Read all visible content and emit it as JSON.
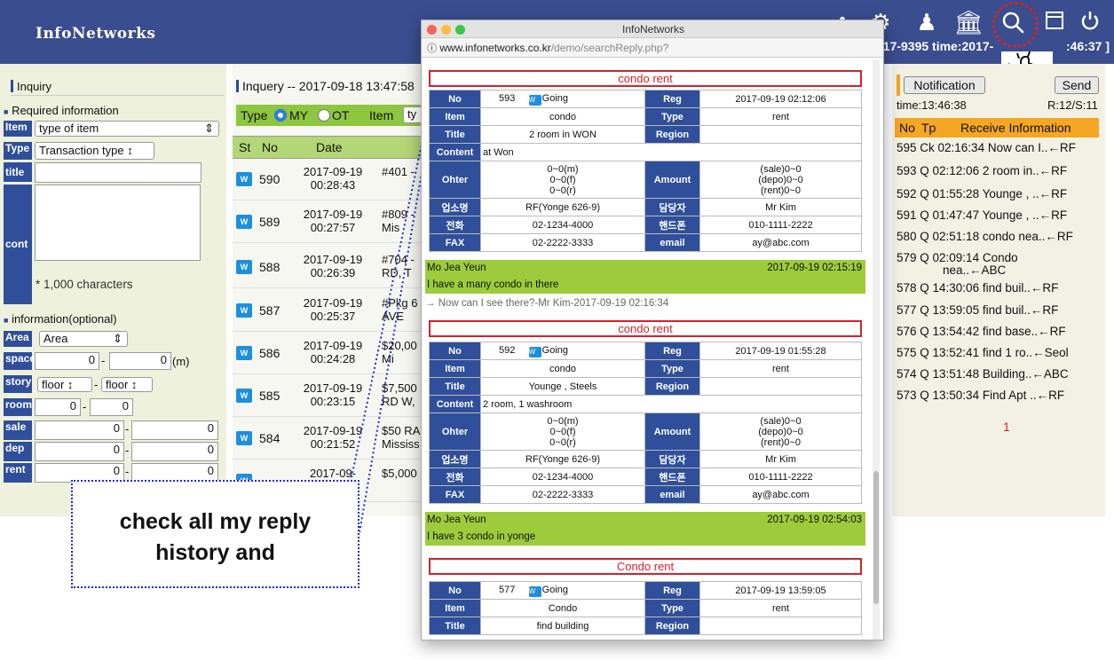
{
  "app": {
    "logo": "InfoNetworks",
    "phone_time": "617-9395 time:2017-",
    "phone_time_end": ":46:37 ]"
  },
  "left": {
    "inquiry_title": "Inquiry",
    "required_info": "Required information",
    "item_label": "Item",
    "item_value": "type of item",
    "type_label": "Type",
    "type_value": "Transaction type ↕",
    "title_label": "title",
    "cont_label": "cont",
    "char_note": "* 1,000 characters",
    "optional_info": "information(optional)",
    "area_label": "Area",
    "area_value": "Area",
    "space_label": "space",
    "space_from": "0",
    "space_to": "0",
    "space_unit": "(m)",
    "story_label": "story",
    "floor1": "floor ↕",
    "floor2": "floor ↕",
    "room_label": "room",
    "room_from": "0",
    "room_to": "0",
    "sale_label": "sale",
    "sale_from": "0",
    "sale_to": "0",
    "dep_label": "dep",
    "dep_from": "0",
    "dep_to": "0",
    "rent_label": "rent",
    "rent_from": "0",
    "rent_to": "0"
  },
  "middle": {
    "title": "Inquery -- 2017-09-18 13:47:58",
    "type_label": "Type",
    "opt_my": "MY",
    "opt_ot": "OT",
    "item_label": "Item",
    "item_sel": "ty",
    "col_st": "St",
    "col_no": "No",
    "col_date": "Date",
    "rows": [
      {
        "no": "590",
        "date1": "2017-09-19",
        "date2": "00:28:43",
        "t1": "#401 -",
        "t2": ""
      },
      {
        "no": "589",
        "date1": "2017-09-19",
        "date2": "00:27:57",
        "t1": "#809 -",
        "t2": "Mis"
      },
      {
        "no": "588",
        "date1": "2017-09-19",
        "date2": "00:26:39",
        "t1": "#704 -",
        "t2": "RD, T"
      },
      {
        "no": "587",
        "date1": "2017-09-19",
        "date2": "00:25:37",
        "t1": "#Pkg 6",
        "t2": "AVE"
      },
      {
        "no": "586",
        "date1": "2017-09-19",
        "date2": "00:24:28",
        "t1": "$20,00",
        "t2": "Mi"
      },
      {
        "no": "585",
        "date1": "2017-09-19",
        "date2": "00:23:15",
        "t1": "$7,500",
        "t2": "RD W,"
      },
      {
        "no": "584",
        "date1": "2017-09-19",
        "date2": "00:21:52",
        "t1": "$50 RA",
        "t2": "Mississ"
      },
      {
        "no": "",
        "date1": "2017-09-",
        "date2": "",
        "t1": "$5,000",
        "t2": ""
      }
    ]
  },
  "right": {
    "notification_btn": "Notification",
    "send_btn": "Send",
    "time": "time:13:46:38",
    "count": "R:12/S:11",
    "col_no": "No",
    "col_tp": "Tp",
    "col_info": "Receive Information",
    "rows": [
      "595 Ck 02:16:34 Now can I..←RF",
      "593 Q 02:12:06 2 room in..←RF",
      "592 Q 01:55:28 Younge , ..←RF",
      "591 Q 01:47:47 Younge , ..←RF",
      "580 Q 02:51:18 condo nea..←RF",
      "579 Q 02:09:14 Condo",
      "578 Q 14:30:06 find buil..←RF",
      "577 Q 13:59:05 find buil..←RF",
      "576 Q 13:54:42 find base..←RF",
      "575 Q 13:52:41 find 1 ro..←Seol",
      "574 Q 13:51:48 Building..←ABC",
      "573 Q 13:50:34 Find Apt ..←RF"
    ],
    "row579_line2": "nea..←ABC",
    "page": "1"
  },
  "popup": {
    "window_title": "InfoNetworks",
    "url_main": "www.infonetworks.co.kr",
    "url_path": "/demo/searchReply.php?",
    "records": [
      {
        "title": "condo  rent",
        "no": "593",
        "status": "Going",
        "reg": "2017-09-19 02:12:06",
        "item": "condo",
        "type": "rent",
        "rtitle": "2 room in WON",
        "region": "",
        "content": "at Won",
        "other": [
          "0~0(m)",
          "0~0(f)",
          "0~0(r)"
        ],
        "amount": [
          "(sale)0~0",
          "(depo)0~0",
          "(rent)0~0"
        ],
        "company": "RF(Yonge 626-9)",
        "manager": "Mr Kim",
        "phone": "02-1234-4000",
        "mobile": "010-1111-2222",
        "fax": "02-2222-3333",
        "email": "ay@abc.com"
      },
      {
        "title": "condo  rent",
        "no": "592",
        "status": "Going",
        "reg": "2017-09-19 01:55:28",
        "item": "condo",
        "type": "rent",
        "rtitle": "Younge , Steels",
        "region": "",
        "content": "2 room, 1 washroom",
        "other": [
          "0~0(m)",
          "0~0(f)",
          "0~0(r)"
        ],
        "amount": [
          "(sale)0~0",
          "(depo)0~0",
          "(rent)0~0"
        ],
        "company": "RF(Yonge 626-9)",
        "manager": "Mr Kim",
        "phone": "02-1234-4000",
        "mobile": "010-1111-2222",
        "fax": "02-2222-3333",
        "email": "ay@abc.com"
      },
      {
        "title": "Condo  rent",
        "no": "577",
        "status": "Going",
        "reg": "2017-09-19 13:59:05",
        "item": "Condo",
        "type": "rent",
        "rtitle": "find building",
        "region": ""
      }
    ],
    "labels": {
      "no": "No",
      "reg": "Reg",
      "item": "Item",
      "type": "Type",
      "title": "Title",
      "region": "Region",
      "content": "Content",
      "other": "Ohter",
      "amount": "Amount",
      "company": "업소명",
      "manager": "담당자",
      "phone": "전화",
      "mobile": "핸드폰",
      "fax": "FAX",
      "email": "email"
    },
    "replies": [
      {
        "name": "Mo Jea Yeun",
        "date": "2017-09-19 02:15:19",
        "msg": "I have a many condo in there",
        "after": "→ Now can I see there?-Mr Kim-2017-09-19 02:16:34"
      },
      {
        "name": "Mo Jea Yeun",
        "date": "2017-09-19 02:54:03",
        "msg": "I have 3 condo in yonge",
        "after": ""
      }
    ]
  },
  "callout": {
    "line1": "check all my reply",
    "line2": "history and"
  },
  "colors": {
    "topbar": "#3a4d8f",
    "label_blue": "#2f4f9b",
    "accent_red": "#d2232a",
    "reply_green": "#9ccc3b",
    "header_orange": "#f5a623",
    "tab_green": "#8dc63f"
  }
}
